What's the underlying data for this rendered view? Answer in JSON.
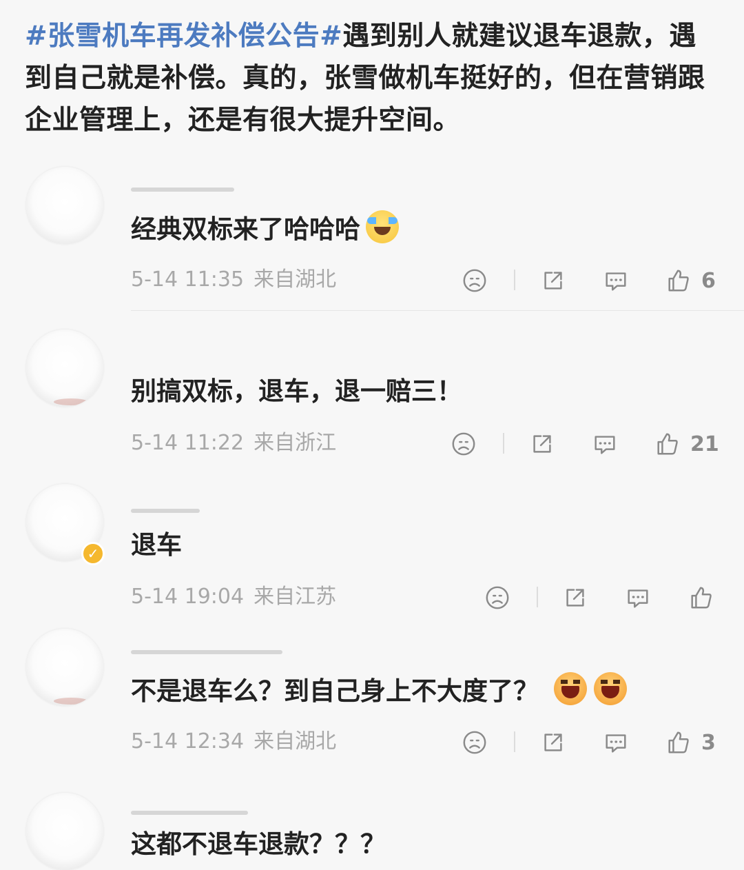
{
  "post": {
    "hashtag": "#张雪机车再发补偿公告#",
    "text": "遇到别人就建议退车退款，遇到自己就是补偿。真的，张雪做机车挺好的，但在营销跟企业管理上，还是有很大提升空间。"
  },
  "comments": [
    {
      "text": "经典双标来了哈哈哈",
      "emoji": [
        "laugh-cry-icon"
      ],
      "time": "5-14 11:35",
      "location": "来自湖北",
      "likes": "6",
      "verified": false
    },
    {
      "text": "别搞双标，退车，退一赔三！",
      "emoji": [],
      "time": "5-14 11:22",
      "location": "来自浙江",
      "likes": "21",
      "verified": false
    },
    {
      "text": "退车",
      "emoji": [],
      "time": "5-14 19:04",
      "location": "来自江苏",
      "likes": "",
      "verified": true
    },
    {
      "text": "不是退车么？到自己身上不大度了？",
      "emoji": [
        "grin-icon",
        "grin-icon"
      ],
      "time": "5-14 12:34",
      "location": "来自湖北",
      "likes": "3",
      "verified": false
    },
    {
      "text": "这都不退车退款？？？",
      "emoji": [],
      "time": "",
      "location": "",
      "likes": "",
      "verified": false
    }
  ],
  "colors": {
    "hashtag": "#4d7bc0",
    "text": "#222222",
    "meta": "#a8a8a8",
    "icon": "#8a8a8a",
    "verified_badge": "#f5b82e",
    "background": "#f7f7f7"
  },
  "icons": [
    "sad-face-icon",
    "share-icon",
    "comment-icon",
    "thumbs-up-icon"
  ]
}
